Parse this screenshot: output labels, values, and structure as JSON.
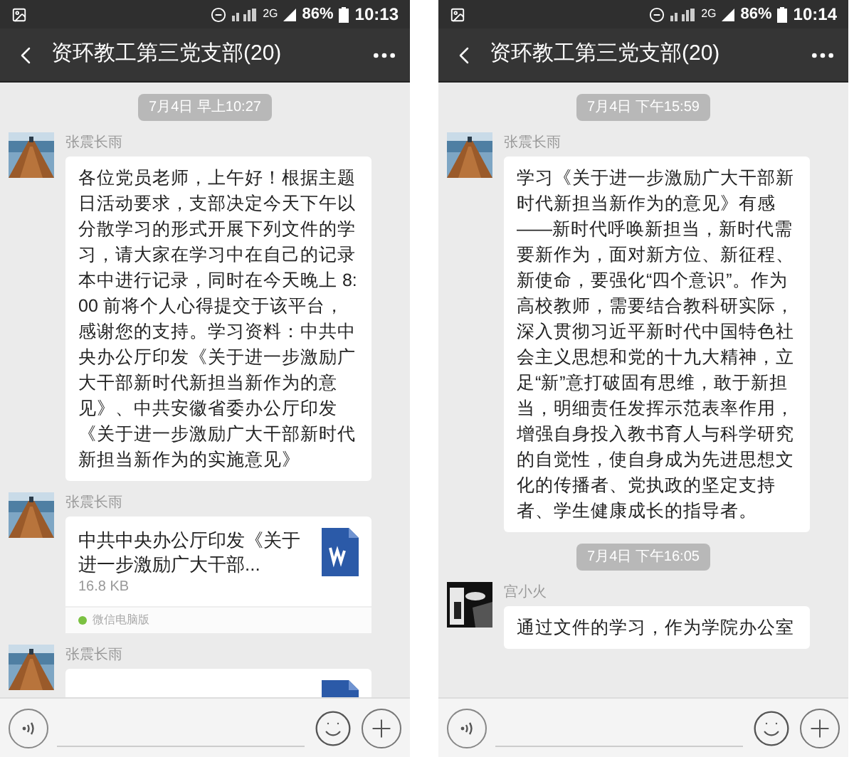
{
  "phones": [
    {
      "status_bar": {
        "network": "2G",
        "battery": "86%",
        "time": "10:13"
      },
      "title": "资环教工第三党支部(20)",
      "messages": [
        {
          "kind": "time",
          "text": "7月4日 早上10:27"
        },
        {
          "kind": "text",
          "sender": "张震长雨",
          "text": "各位党员老师，上午好！根据主题日活动要求，支部决定今天下午以分散学习的形式开展下列文件的学习，请大家在学习中在自己的记录本中进行记录，同时在今天晚上 8:00 前将个人心得提交于该平台，感谢您的支持。学习资料：中共中央办公厅印发《关于进一步激励广大干部新时代新担当新作为的意见》、中共安徽省委办公厅印发《关于进一步激励广大干部新时代新担当新作为的实施意见》"
        },
        {
          "kind": "file",
          "sender": "张震长雨",
          "file_name": "中共中央办公厅印发《关于进一步激励广大干部...",
          "size": "16.8 KB",
          "source": "微信电脑版"
        },
        {
          "kind": "file",
          "sender": "张震长雨"
        }
      ]
    },
    {
      "status_bar": {
        "network": "2G",
        "battery": "86%",
        "time": "10:14"
      },
      "title": "资环教工第三党支部(20)",
      "messages": [
        {
          "kind": "time",
          "text": "7月4日 下午15:59"
        },
        {
          "kind": "text",
          "sender": "张震长雨",
          "text": "学习《关于进一步激励广大干部新时代新担当新作为的意见》有感——新时代呼唤新担当，新时代需要新作为，面对新方位、新征程、新使命，要强化“四个意识”。作为高校教师，需要结合教科研实际，深入贯彻习近平新时代中国特色社会主义思想和党的十九大精神，立足“新”意打破固有思维，敢于新担当，明细责任发挥示范表率作用，增强自身投入教书育人与科学研究的自觉性，使自身成为先进思想文化的传播者、党执政的坚定支持者、学生健康成长的指导者。"
        },
        {
          "kind": "time",
          "text": "7月4日 下午16:05"
        },
        {
          "kind": "text",
          "sender": "宫小火",
          "text": "通过文件的学习，作为学院办公室"
        }
      ]
    }
  ]
}
